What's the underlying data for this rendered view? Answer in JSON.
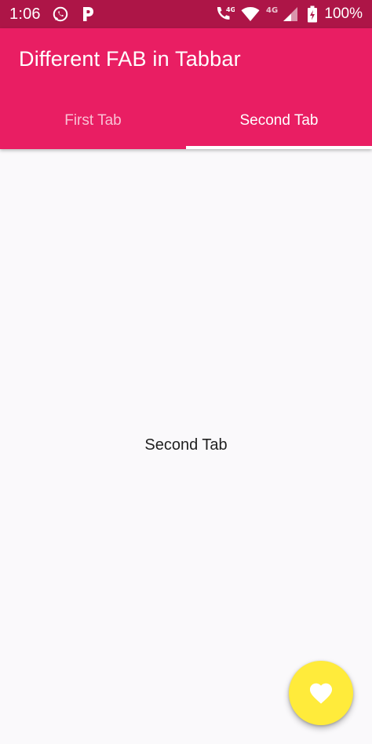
{
  "status_bar": {
    "time": "1:06",
    "battery": "100%",
    "network_primary": "4G",
    "network_secondary": "4G",
    "icons": [
      "whatsapp-icon",
      "p-app-icon",
      "wifi-calling-icon",
      "wifi-icon",
      "signal-icon",
      "battery-charging-icon"
    ]
  },
  "app_bar": {
    "title": "Different FAB in Tabbar",
    "color": "#e91e63"
  },
  "tabs": [
    {
      "label": "First Tab",
      "active": false
    },
    {
      "label": "Second Tab",
      "active": true
    }
  ],
  "content": {
    "text": "Second Tab"
  },
  "fab": {
    "icon": "heart-icon",
    "color": "#ffeb3b"
  }
}
